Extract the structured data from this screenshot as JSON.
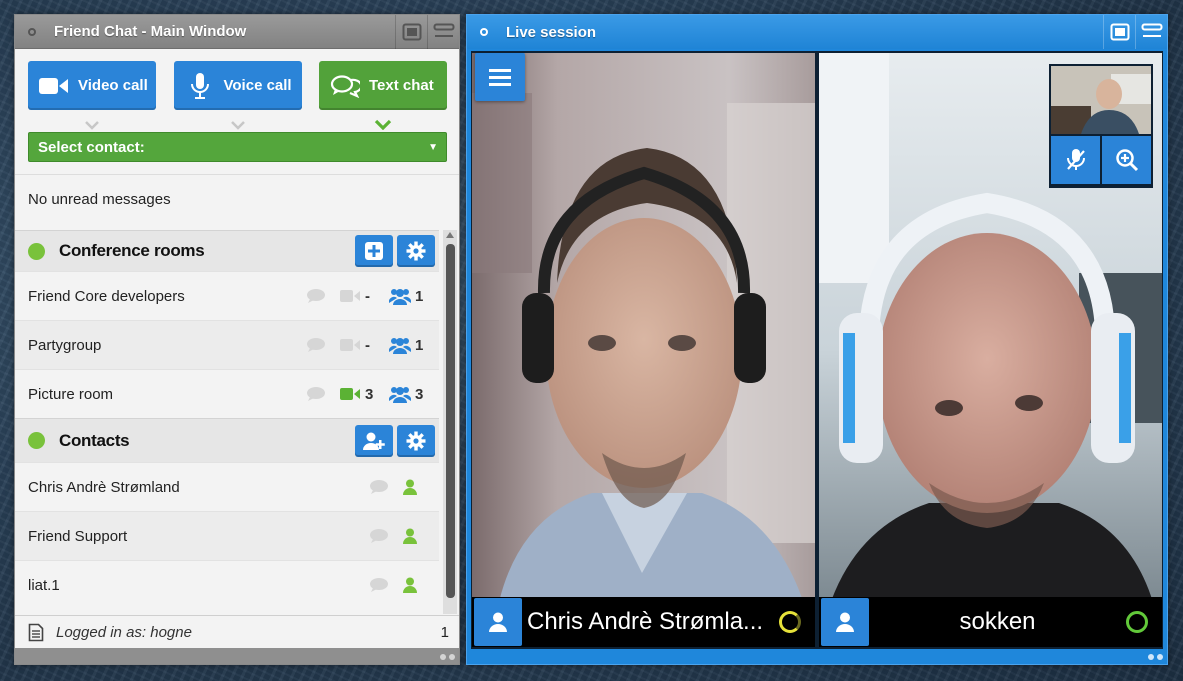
{
  "main_window": {
    "title": "Friend Chat - Main Window",
    "buttons": {
      "video_call": "Video call",
      "voice_call": "Voice call",
      "text_chat": "Text chat"
    },
    "select_contact": "Select contact:",
    "unread": "No unread messages",
    "conference": {
      "title": "Conference rooms",
      "rooms": [
        {
          "name": "Friend Core developers",
          "video": "-",
          "members": "1"
        },
        {
          "name": "Partygroup",
          "video": "-",
          "members": "1"
        },
        {
          "name": "Picture room",
          "video": "3",
          "members": "3"
        }
      ]
    },
    "contacts": {
      "title": "Contacts",
      "items": [
        {
          "name": "Chris Andrè Strømland"
        },
        {
          "name": "Friend Support"
        },
        {
          "name": "liat.1"
        }
      ]
    },
    "footer": {
      "logged_in": "Logged in as: hogne",
      "count": "1"
    }
  },
  "live_window": {
    "title": "Live session",
    "participants": [
      {
        "name": "Chris Andrè Strømla...",
        "status_color": "#e7e23a"
      },
      {
        "name": "sokken",
        "status_color": "#62c93a"
      }
    ]
  },
  "colors": {
    "accent_blue": "#2b84d8",
    "green": "#52a23a",
    "status_green": "#79c23b"
  }
}
